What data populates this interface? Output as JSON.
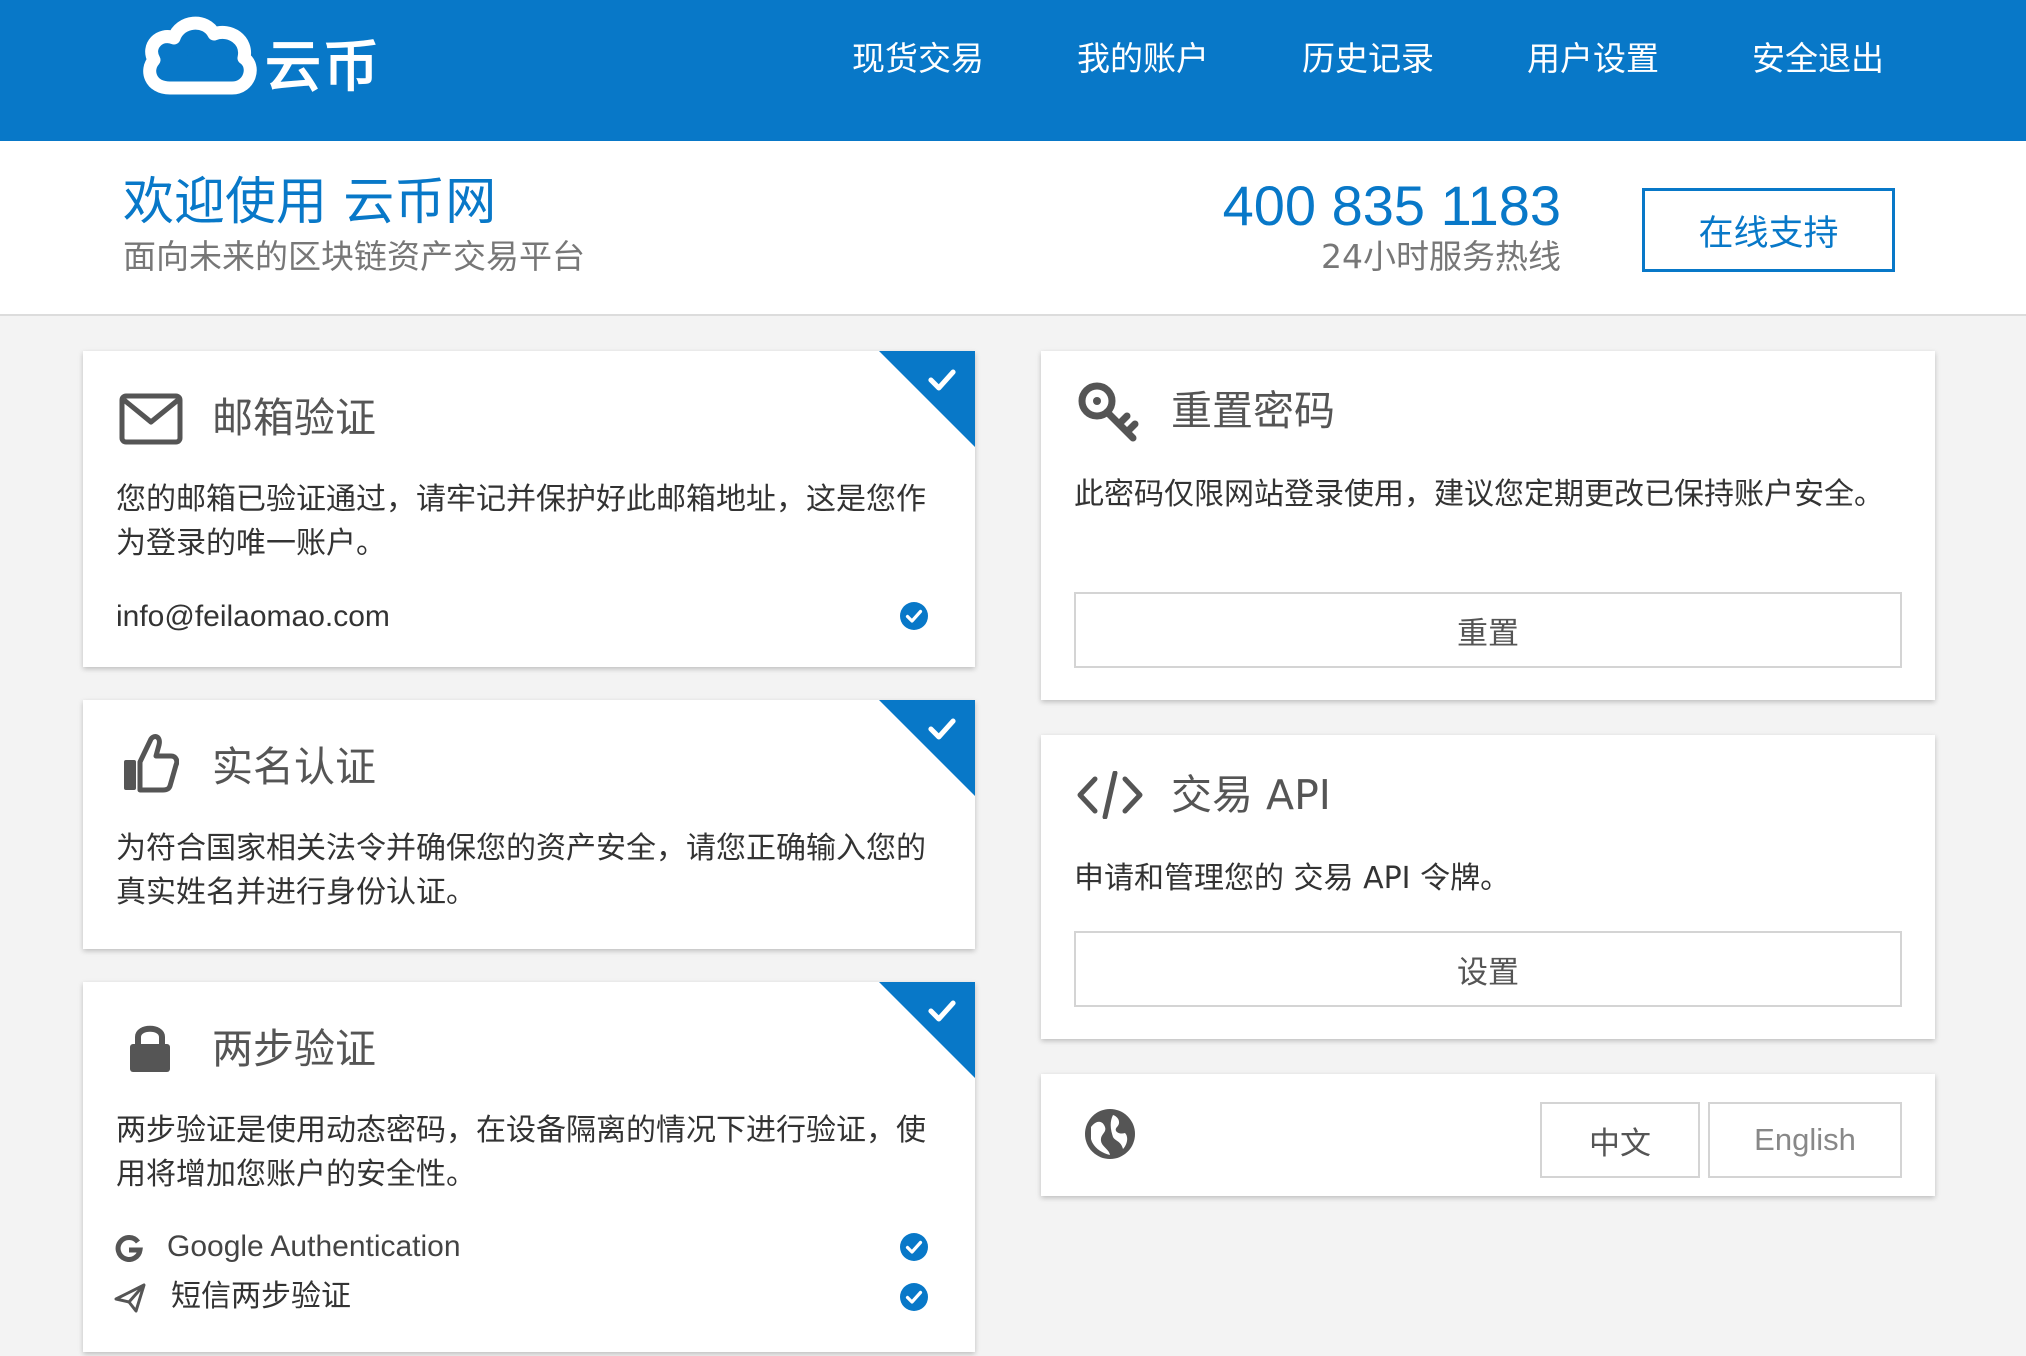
{
  "brand": {
    "logo_text": "云币"
  },
  "nav": {
    "spot_trading": "现货交易",
    "my_account": "我的账户",
    "history": "历史记录",
    "user_settings": "用户设置",
    "logout": "安全退出"
  },
  "header": {
    "title": "欢迎使用 云币网",
    "subtitle": "面向未来的区块链资产交易平台",
    "phone": "400 835 1183",
    "hotline_label": "24小时服务热线",
    "support_button": "在线支持"
  },
  "cards": {
    "email": {
      "title": "邮箱验证",
      "description": "您的邮箱已验证通过，请牢记并保护好此邮箱地址，这是您作为登录的唯一账户。",
      "address": "info@feilaomao.com",
      "verified": true,
      "icon": "envelope-icon"
    },
    "realname": {
      "title": "实名认证",
      "description": "为符合国家相关法令并确保您的资产安全，请您正确输入您的真实姓名并进行身份认证。",
      "verified": true,
      "icon": "thumbs-up-icon"
    },
    "twofactor": {
      "title": "两步验证",
      "description": "两步验证是使用动态密码，在设备隔离的情况下进行验证，使用将增加您账户的安全性。",
      "verified": true,
      "icon": "lock-icon",
      "methods": [
        {
          "label": "Google Authentication",
          "icon": "google-icon",
          "enabled": true
        },
        {
          "label": "短信两步验证",
          "icon": "paper-plane-icon",
          "enabled": true
        }
      ]
    },
    "password": {
      "title": "重置密码",
      "description": "此密码仅限网站登录使用，建议您定期更改已保持账户安全。",
      "button": "重置",
      "icon": "key-icon"
    },
    "api": {
      "title": "交易 API",
      "description": "申请和管理您的 交易 API 令牌。",
      "button": "设置",
      "icon": "code-icon"
    },
    "language": {
      "icon": "globe-icon",
      "options": [
        "中文",
        "English"
      ]
    }
  },
  "colors": {
    "brand_blue": "#0878c8",
    "background": "#f3f3f3",
    "card_border": "#d4d4d4"
  }
}
